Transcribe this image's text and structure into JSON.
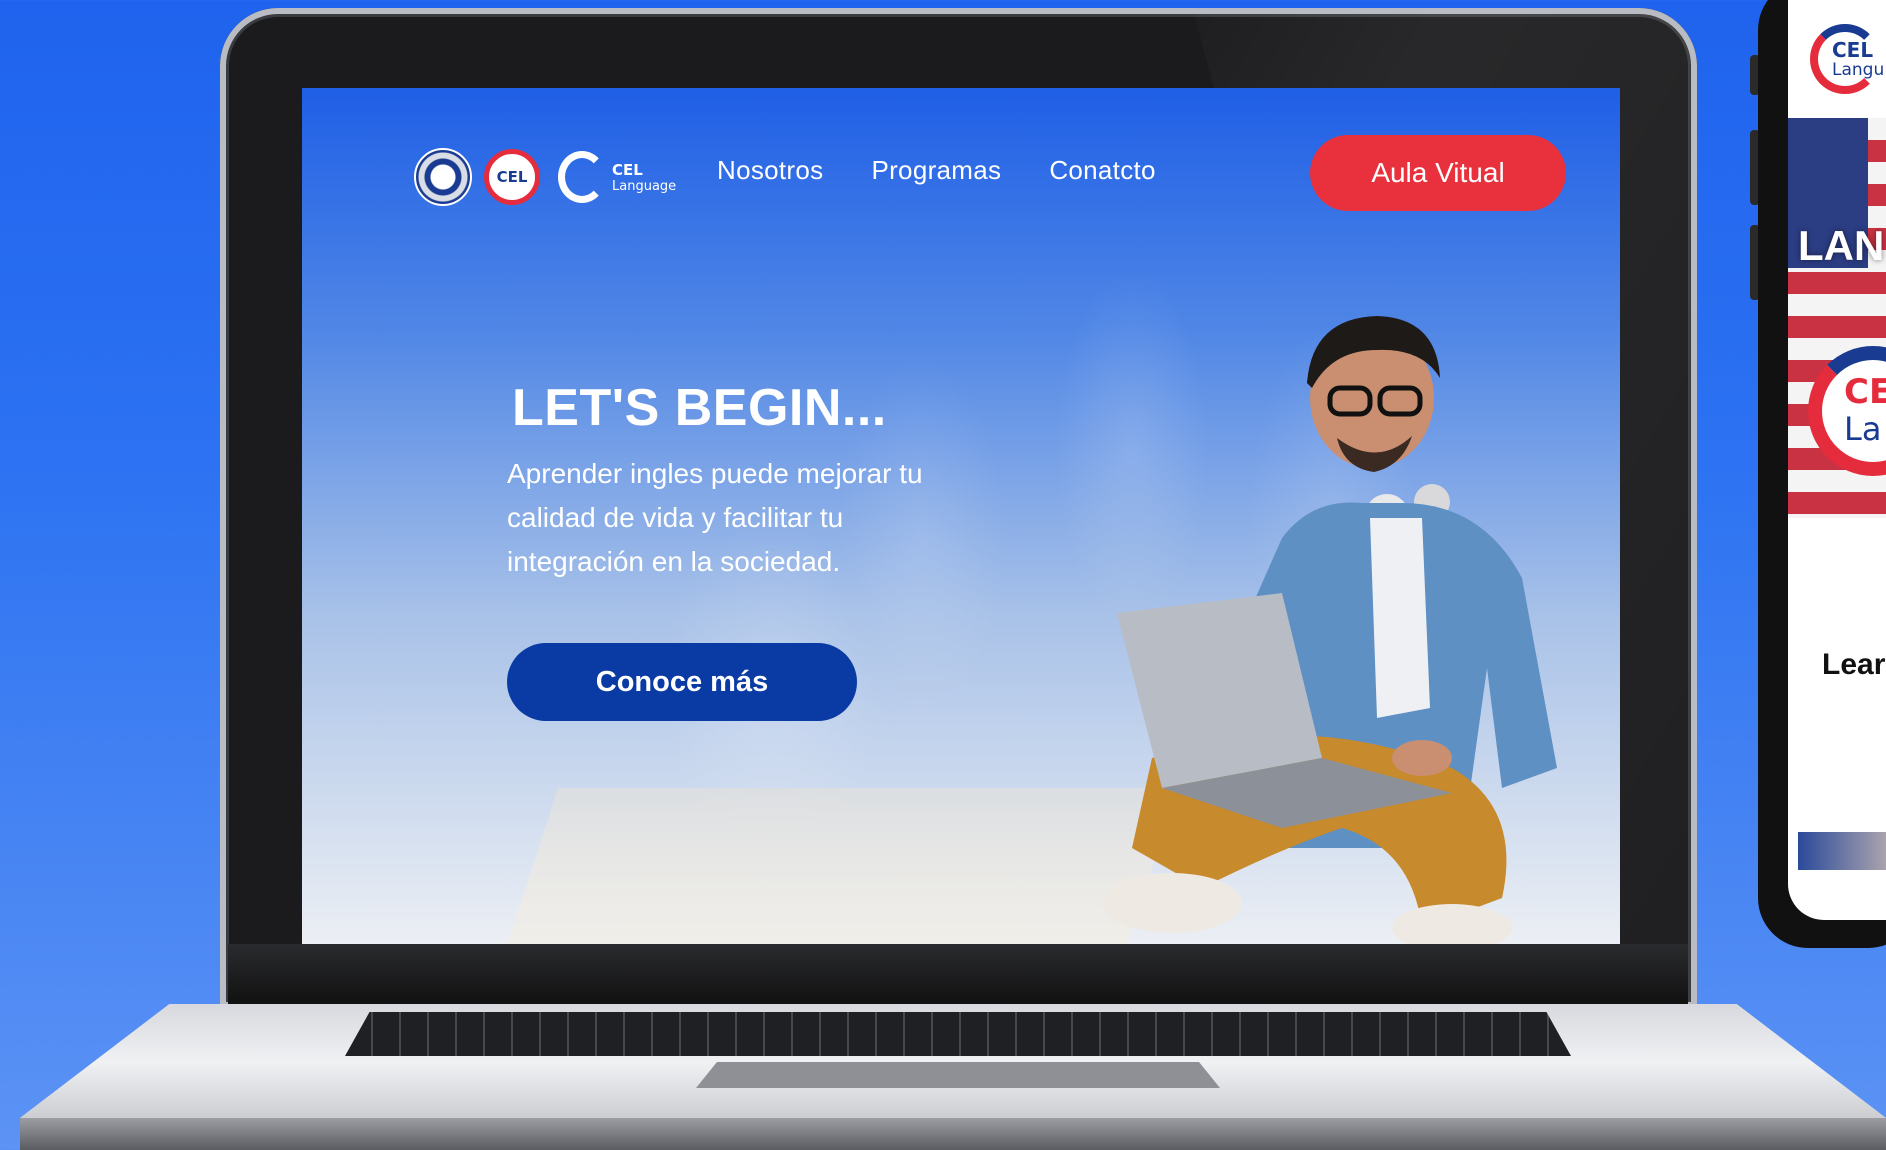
{
  "site": {
    "logos": {
      "badge": "CEL",
      "brand_top": "CEL",
      "brand_bottom": "Language"
    },
    "nav": {
      "items": [
        "Nosotros",
        "Programas",
        "Conatcto"
      ],
      "cta_label": "Aula Vitual"
    },
    "hero": {
      "title": "LET'S BEGIN...",
      "subtitle": "Aprender ingles puede mejorar tu calidad de vida y facilitar tu integración en la sociedad.",
      "button_label": "Conoce más"
    }
  },
  "phone": {
    "logo_top": "CEL",
    "logo_bottom": "Langu",
    "banner_text": "LAN",
    "big_logo_top": "CE",
    "big_logo_bottom": "La",
    "learn_text": "Lear"
  },
  "colors": {
    "brand_blue": "#0a3aa3",
    "brand_red": "#e8313d",
    "background_blue": "#1f63ee"
  }
}
